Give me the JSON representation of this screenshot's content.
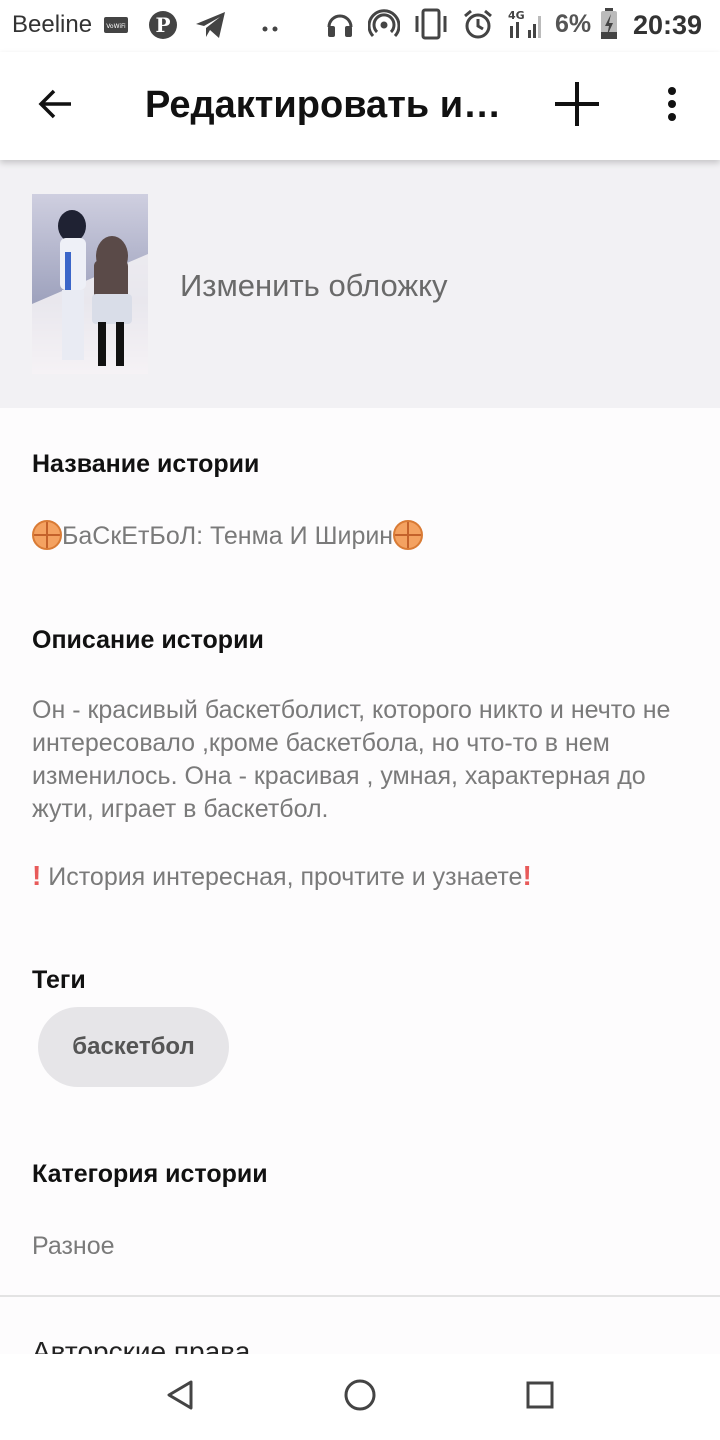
{
  "status_bar": {
    "carrier": "Beeline",
    "battery": "6%",
    "time": "20:39",
    "icons": [
      "vowifi-icon",
      "pinterest-icon",
      "telegram-icon",
      "more-dots-icon",
      "headphones-icon",
      "hotspot-icon",
      "vibrate-icon",
      "alarm-icon",
      "signal-4g-icon",
      "battery-charging-icon"
    ]
  },
  "app_bar": {
    "title": "Редактировать и…",
    "icons": [
      "back-arrow-icon",
      "add-icon",
      "more-vert-icon"
    ]
  },
  "cover": {
    "change_label": "Изменить обложку"
  },
  "story": {
    "title_label": "Название истории",
    "title_value": "БаСкЕтБоЛ: Тенма И Ширин",
    "description_label": "Описание истории",
    "description_value": "Он - красивый баскетболист, которого никто и нечто  не интересовало ,кроме баскетбола, но что-то в нем изменилось. Она - красивая , умная, характерная до жути, играет в баскетбол.",
    "description_note": " История интересная, прочтите и узнаете",
    "tags_label": "Теги",
    "tags": [
      "баскетбол"
    ],
    "category_label": "Категория истории",
    "category_value": "Разное",
    "copyright_label": "Авторские права"
  },
  "colors": {
    "accent_text": "#111111",
    "secondary_text": "#7a7a7a",
    "chip_bg": "#e6e5e8",
    "ball_emoji": "#f4a261",
    "exclamation": "#e85a5a"
  },
  "nav_bar": {
    "icons": [
      "nav-back-icon",
      "nav-home-icon",
      "nav-recents-icon"
    ]
  }
}
